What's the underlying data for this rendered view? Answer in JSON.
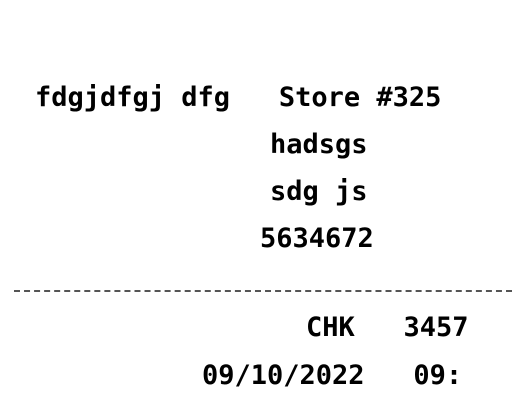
{
  "receipt": {
    "store_line": "fdgjdfgj dfg   Store #325",
    "address_line1": "hadsgs",
    "address_line2": "sdg js",
    "phone": "5634672",
    "check_line": "CHK   3457",
    "date_line": "09/10/2022   09:"
  }
}
